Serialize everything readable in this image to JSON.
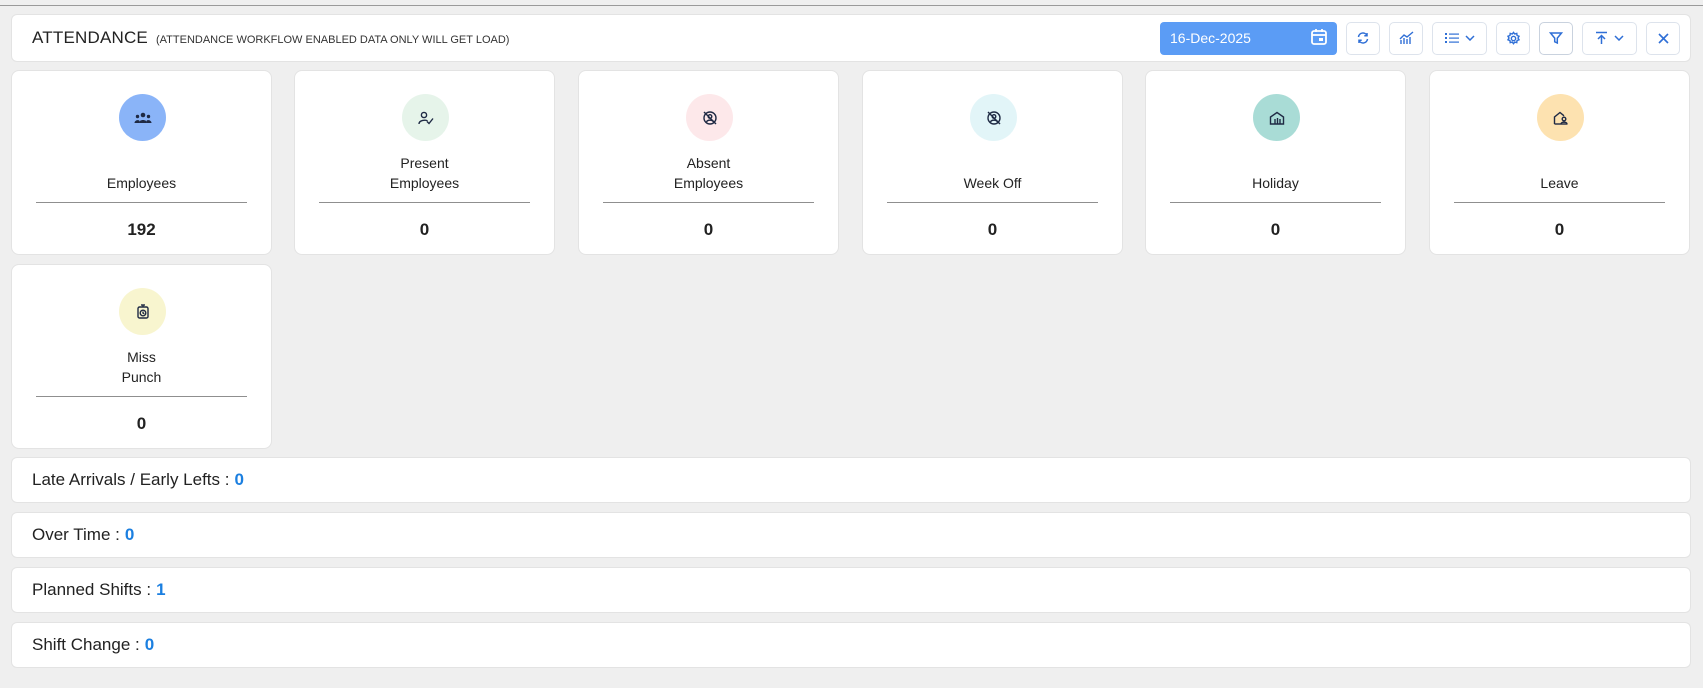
{
  "header": {
    "title": "ATTENDANCE",
    "subtitle": "(ATTENDANCE WORKFLOW ENABLED DATA ONLY WILL GET LOAD)",
    "date_value": "16-Dec-2025"
  },
  "toolbar": {
    "icons": [
      "calendar-icon",
      "refresh-icon",
      "chart-icon",
      "list-view-icon",
      "settings-icon",
      "filter-icon",
      "export-icon",
      "close-icon"
    ]
  },
  "cards": [
    {
      "label": "Employees",
      "value": "192",
      "icon": "employees-icon",
      "color": "#8ab4f8"
    },
    {
      "label": "Present Employees",
      "value": "0",
      "icon": "present-icon",
      "color": "#e6f4ea"
    },
    {
      "label": "Absent Employees",
      "value": "0",
      "icon": "absent-icon",
      "color": "#fde8ea"
    },
    {
      "label": "Week Off",
      "value": "0",
      "icon": "week-off-icon",
      "color": "#e2f5f8"
    },
    {
      "label": "Holiday",
      "value": "0",
      "icon": "holiday-icon",
      "color": "#a9dcd6"
    },
    {
      "label": "Leave",
      "value": "0",
      "icon": "leave-icon",
      "color": "#fde2b0"
    },
    {
      "label": "Miss Punch",
      "value": "0",
      "icon": "miss-punch-icon",
      "color": "#f8f5cf"
    }
  ],
  "rows": [
    {
      "label": "Late Arrivals / Early Lefts :",
      "value": "0"
    },
    {
      "label": "Over Time :",
      "value": "0"
    },
    {
      "label": "Planned Shifts :",
      "value": "1"
    },
    {
      "label": "Shift Change :",
      "value": "0"
    }
  ],
  "colors": {
    "accent": "#5b9cf5",
    "number": "#1b7fe0"
  }
}
